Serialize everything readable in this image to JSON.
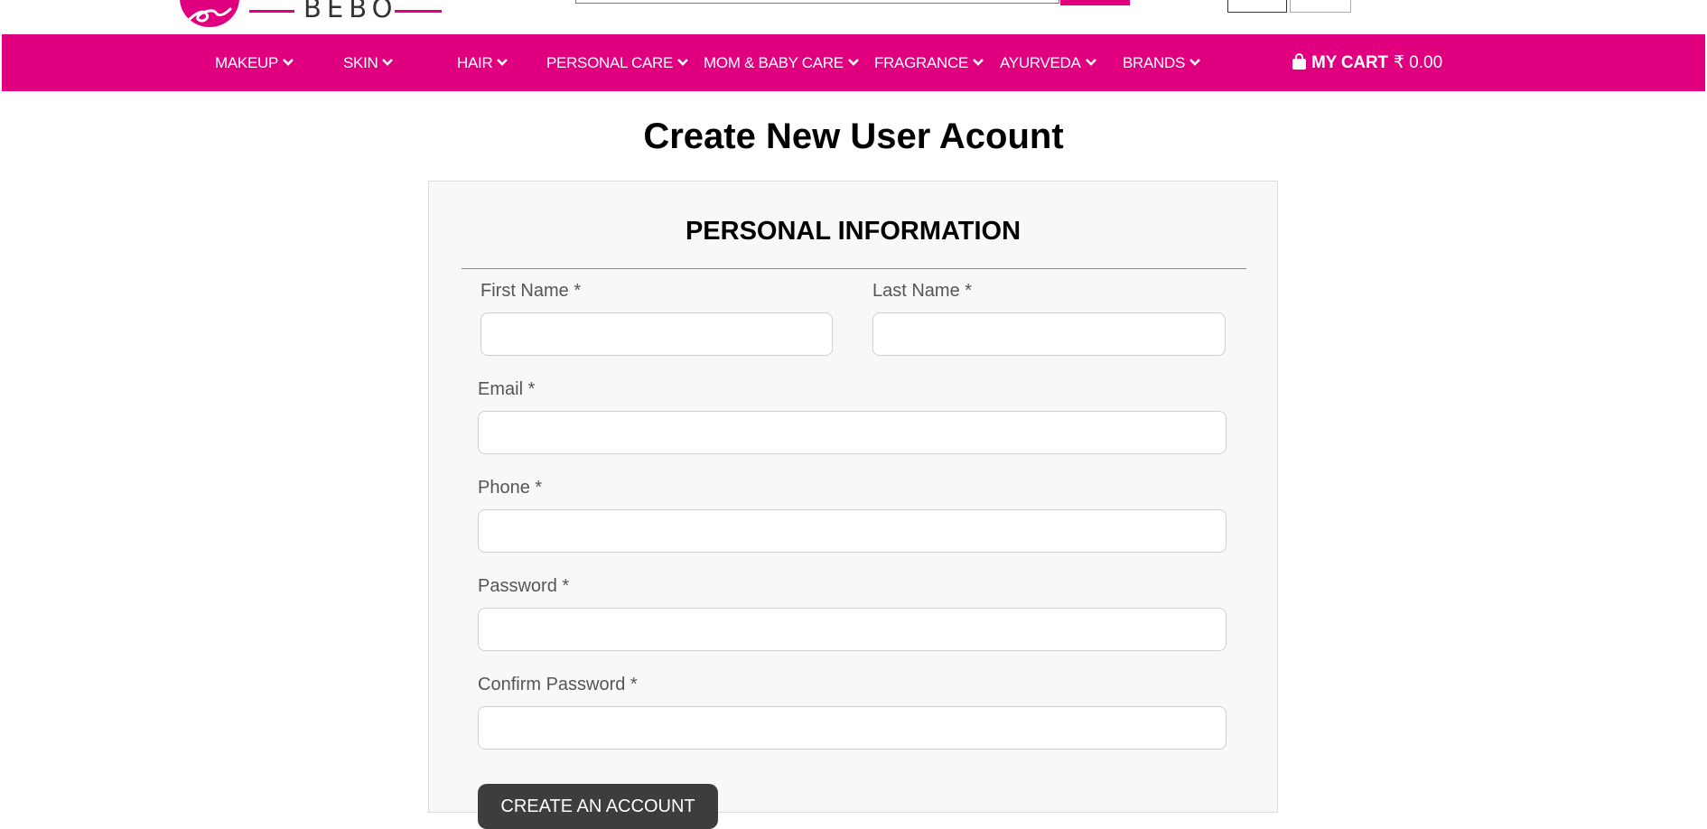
{
  "header": {
    "logo_text": "BEBO"
  },
  "nav": {
    "items": [
      {
        "label": "MAKEUP"
      },
      {
        "label": "SKIN"
      },
      {
        "label": "HAIR"
      },
      {
        "label": "PERSONAL CARE"
      },
      {
        "label": "MOM & BABY CARE"
      },
      {
        "label": "FRAGRANCE"
      },
      {
        "label": "AYURVEDA"
      },
      {
        "label": "BRANDS"
      }
    ],
    "cart_label": "MY CART",
    "cart_amount": "₹ 0.00"
  },
  "page": {
    "title": "Create New User Acount"
  },
  "form": {
    "section_title": "PERSONAL INFORMATION",
    "first_name": {
      "label": "First Name *",
      "value": ""
    },
    "last_name": {
      "label": "Last Name *",
      "value": ""
    },
    "email": {
      "label": "Email *",
      "value": ""
    },
    "phone": {
      "label": "Phone *",
      "value": ""
    },
    "password": {
      "label": "Password *",
      "value": ""
    },
    "confirm_password": {
      "label": "Confirm Password *",
      "value": ""
    },
    "submit_label": "CREATE AN ACCOUNT"
  },
  "colors": {
    "brand": "#e0007f",
    "button": "#3d3d3d",
    "panel_bg": "#f8f8f8"
  },
  "icons": {
    "nav_chevron": "chevron-down-icon",
    "cart": "shopping-bag-icon"
  }
}
